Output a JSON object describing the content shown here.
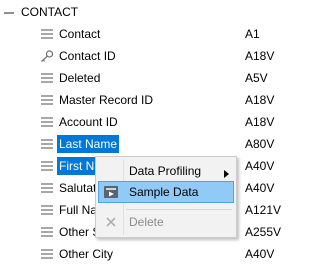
{
  "tree": {
    "root": {
      "label": "CONTACT",
      "toggle_icon": "collapse-minus-icon"
    },
    "fields": [
      {
        "name": "Contact",
        "type": "A1",
        "icon": "field-icon",
        "selected": false
      },
      {
        "name": "Contact ID",
        "type": "A18V",
        "icon": "key-icon",
        "selected": false
      },
      {
        "name": "Deleted",
        "type": "A5V",
        "icon": "field-icon",
        "selected": false
      },
      {
        "name": "Master Record ID",
        "type": "A18V",
        "icon": "field-icon",
        "selected": false
      },
      {
        "name": "Account ID",
        "type": "A18V",
        "icon": "field-icon",
        "selected": false
      },
      {
        "name": "Last Name",
        "type": "A80V",
        "icon": "field-icon",
        "selected": true
      },
      {
        "name": "First Na",
        "type": "A40V",
        "icon": "field-icon",
        "selected": true
      },
      {
        "name": "Salutat",
        "type": "A40V",
        "icon": "field-icon",
        "selected": false
      },
      {
        "name": "Full Na",
        "type": "A121V",
        "icon": "field-icon",
        "selected": false
      },
      {
        "name": "Other St",
        "type": "A255V",
        "icon": "field-icon",
        "selected": false
      },
      {
        "name": "Other City",
        "type": "A40V",
        "icon": "field-icon",
        "selected": false
      }
    ]
  },
  "context_menu": {
    "items": [
      {
        "label": "Data Profiling",
        "icon": "",
        "has_submenu": true,
        "enabled": true,
        "highlighted": false
      },
      {
        "label": "Sample Data",
        "icon": "sample-data-icon",
        "has_submenu": false,
        "enabled": true,
        "highlighted": true
      },
      {
        "label": "Delete",
        "icon": "delete-icon",
        "has_submenu": false,
        "enabled": false,
        "highlighted": false
      }
    ]
  },
  "colors": {
    "selection": "#0078d7",
    "menu_highlight": "#91c9f7",
    "menu_background": "#f2f2f2",
    "disabled_text": "#8c8c8c"
  }
}
